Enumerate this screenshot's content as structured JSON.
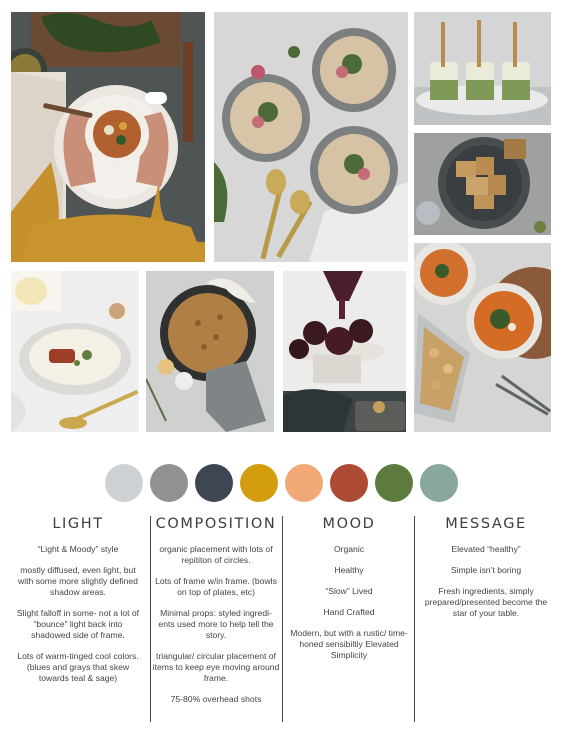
{
  "collage": {
    "photos": [
      {
        "name": "photo-hands-holding-soup"
      },
      {
        "name": "photo-three-soup-bowls"
      },
      {
        "name": "photo-parfait-jars"
      },
      {
        "name": "photo-croutons-plate"
      },
      {
        "name": "photo-creamy-soup-bowl"
      },
      {
        "name": "photo-skillet-bread"
      },
      {
        "name": "photo-chocolate-cakes"
      },
      {
        "name": "photo-orange-soup-table"
      }
    ]
  },
  "palette": {
    "colors": [
      "#cdd1d4",
      "#8f9290",
      "#3e4553",
      "#d49d0f",
      "#f2a978",
      "#ae4b35",
      "#5d7b3e",
      "#87a89a"
    ]
  },
  "columns": {
    "light": {
      "title": "LIGHT",
      "items": [
        "“Light & Moody” style",
        "mostly diffused, even light, but with some more slightly defined shadow areas.",
        "Slight falloff in some- not a lot of “bounce” light back into shadowed side of frame.",
        "Lots of warm-tinged cool colors. (blues and grays that skew towards teal & sage)"
      ]
    },
    "composition": {
      "title": "COMPOSITION",
      "items": [
        "organic placement with lots of repititon of circles.",
        "Lots of frame w/in frame. (bowls on top of plates, etc)",
        "Minimal props: styled ingredi- ents used more to help tell the story.",
        "triangular/ circular placement of items to keep eye moving around frame.",
        "75-80% overhead shots"
      ]
    },
    "mood": {
      "title": "MOOD",
      "items": [
        "Organic",
        "Healthy",
        "“Slow” Lived",
        "Hand Crafted",
        "Modern, but with a rustic/ time-honed sensibiltiy Elevated Simplicity"
      ]
    },
    "message": {
      "title": "MESSAGE",
      "items": [
        "Elevated “healthy”",
        "Simple isn’t boring",
        "Fresh ingredients, simply prepared/presented become the star of your table."
      ]
    }
  }
}
